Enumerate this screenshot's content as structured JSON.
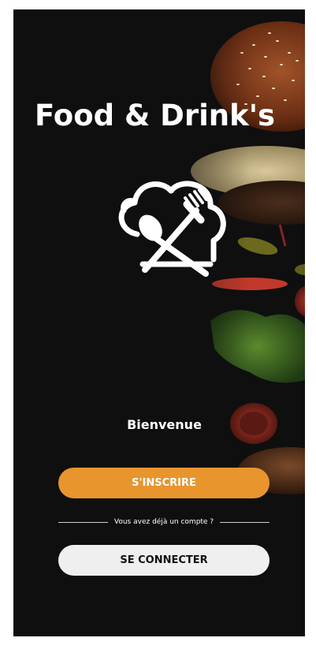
{
  "app": {
    "title": "Food & Drink's"
  },
  "welcome": {
    "text": "Bienvenue"
  },
  "actions": {
    "signup_label": "S'INSCRIRE",
    "login_label": "SE CONNECTER",
    "divider_text": "Vous avez déjà un compte ?"
  },
  "colors": {
    "background": "#0f0f0f",
    "accent": "#e8952e",
    "secondary_button": "#efefef"
  },
  "icons": [
    "chef-hat-utensils-logo"
  ]
}
